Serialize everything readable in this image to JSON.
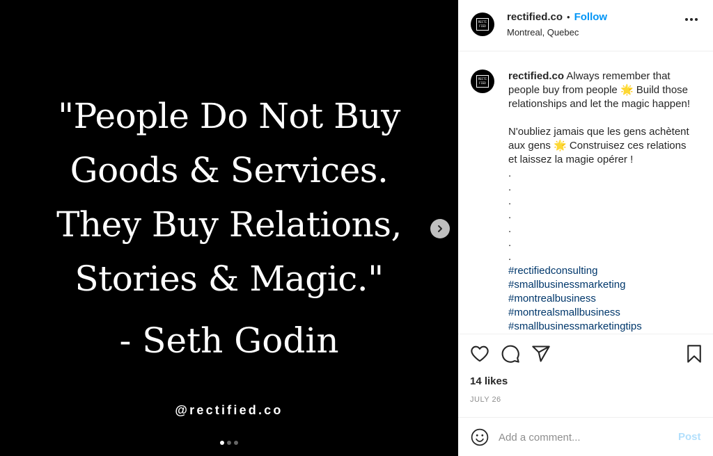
{
  "media": {
    "quote_lines": [
      "\"People Do Not Buy",
      "Goods & Services.",
      "They Buy Relations,",
      "Stories & Magic.\""
    ],
    "attribution": "- Seth Godin",
    "watermark": "@rectified.co",
    "carousel": {
      "total": 3,
      "active": 1
    }
  },
  "header": {
    "username": "rectified.co",
    "separator": "•",
    "follow_label": "Follow",
    "location": "Montreal, Quebec",
    "avatar_mark": [
      "RECTI",
      "FIED"
    ]
  },
  "caption": {
    "username": "rectified.co",
    "text_en_1": "Always remember that",
    "text_en_2": "people buy from people 🌟 Build those",
    "text_en_3": "relationships and let the magic happen!",
    "text_fr_1": "N'oubliez jamais que les gens achètent",
    "text_fr_2": "aux gens 🌟 Construisez ces relations",
    "text_fr_3": "et laissez la magie opérer !",
    "dots": [
      ".",
      ".",
      ".",
      ".",
      ".",
      ".",
      "."
    ],
    "hashtags": [
      "#rectifiedconsulting",
      "#smallbusinessmarketing",
      "#montrealbusiness",
      "#montrealsmallbusiness",
      "#smallbusinessmarketingtips"
    ]
  },
  "actions": {
    "icons": [
      "heart-icon",
      "comment-icon",
      "share-icon",
      "bookmark-icon"
    ]
  },
  "likes_text": "14 likes",
  "date_text": "JULY 26",
  "comment": {
    "placeholder": "Add a comment...",
    "post_label": "Post"
  },
  "colors": {
    "follow": "#0095f6",
    "hashtag": "#00376b",
    "post_disabled": "#b2dffc",
    "muted": "#8e8e8e"
  }
}
